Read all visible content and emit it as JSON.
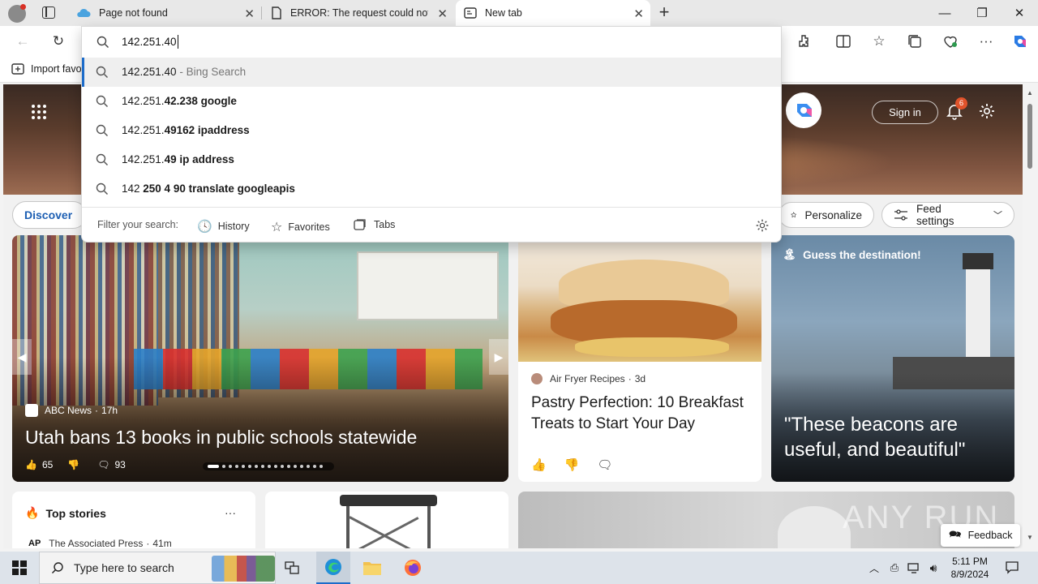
{
  "tabs": [
    {
      "title": "Page not found",
      "icon": "cloud-icon"
    },
    {
      "title": "ERROR: The request could not be satisfied",
      "icon": "document-icon"
    },
    {
      "title": "New tab",
      "icon": "newtab-icon"
    }
  ],
  "address_bar": {
    "value": "142.251.40"
  },
  "favorites_bar": {
    "import_label": "Import favo"
  },
  "suggestions": [
    {
      "prefix": "142.251.40",
      "bold": "",
      "suffix": " - Bing Search"
    },
    {
      "prefix": "142.251.",
      "bold": "42.238 google",
      "suffix": ""
    },
    {
      "prefix": "142.251.",
      "bold": "49162 ipaddress",
      "suffix": ""
    },
    {
      "prefix": "142.251.",
      "bold": "49 ip address",
      "suffix": ""
    },
    {
      "prefix": "142 ",
      "bold": "250 4 90 translate googleapis",
      "suffix": ""
    }
  ],
  "filter": {
    "label": "Filter your search:",
    "history": "History",
    "favorites": "Favorites",
    "tabs": "Tabs"
  },
  "header": {
    "sign_in": "Sign in",
    "notification_count": "6"
  },
  "nav": {
    "discover": "Discover",
    "personalize": "Personalize",
    "feed_settings": "Feed settings"
  },
  "main_story": {
    "source": "ABC News",
    "age": "17h",
    "headline": "Utah bans 13 books in public schools statewide",
    "likes": "65",
    "comments": "93"
  },
  "recipe_card": {
    "source": "Air Fryer Recipes",
    "age": "3d",
    "headline": "Pastry Perfection: 10 Breakfast Treats to Start Your Day"
  },
  "destination_card": {
    "label": "Guess the destination!",
    "quote": "\"These beacons are useful, and beautiful\""
  },
  "top_stories": {
    "title": "Top stories",
    "more": "···",
    "source_logo": "AP",
    "source": "The Associated Press",
    "age": "41m"
  },
  "feedback": "Feedback",
  "watermark": "ANY RUN",
  "taskbar": {
    "search_placeholder": "Type here to search",
    "time": "5:11 PM",
    "date": "8/9/2024"
  },
  "colors": {
    "accent": "#1d6cc9",
    "badge": "#e0532b"
  }
}
